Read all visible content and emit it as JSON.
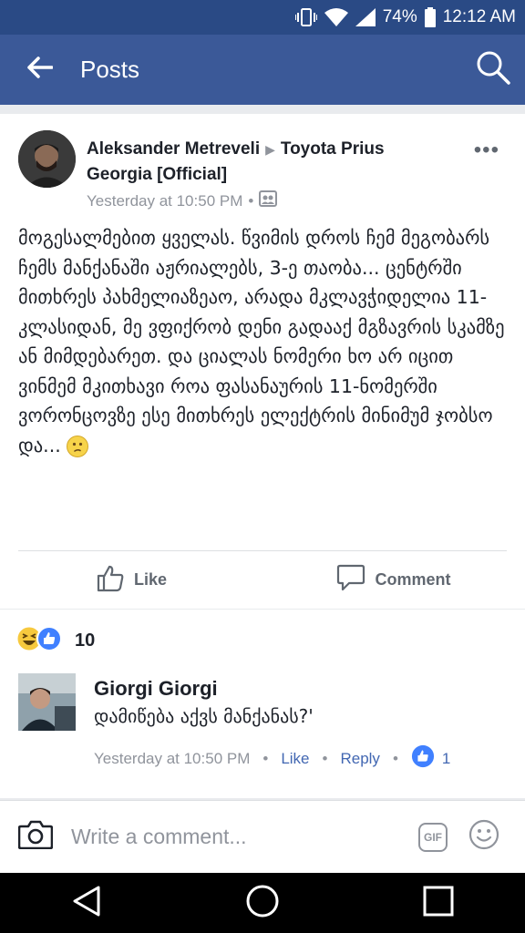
{
  "status_bar": {
    "battery": "74%",
    "time": "12:12 AM"
  },
  "app_bar": {
    "title": "Posts"
  },
  "post": {
    "author": "Aleksander Metreveli",
    "target": "Toyota Prius Georgia [Official]",
    "timestamp": "Yesterday at 10:50 PM",
    "text": "მოგესალმებით ყველას. წვიმის დროს ჩემ მეგობარს ჩემს მანქანაში აჟრიალებს, 3-ე თაობა... ცენტრში მითხრეს პახმელიაზეაო, არადა მკლავჭიდელია 11-კლასიდან, მე ვფიქრობ დენი გადააქ მგზავრის სკამზე ან მიმდებარეთ. და ციალას ნომერი ხო არ იცით ვინმემ მკითხავი როა ფასანაურის 11-ნომერში ვორონცოვზე ესე მითხრეს ელექტრის მინიმუმ ჯობსო და...",
    "like_label": "Like",
    "comment_label": "Comment"
  },
  "reactions": {
    "count": "10"
  },
  "comment": {
    "author": "Giorgi Giorgi",
    "text": "დამიწება აქვს მანქანას?'",
    "timestamp": "Yesterday at 10:50 PM",
    "like_label": "Like",
    "reply_label": "Reply",
    "like_count": "1"
  },
  "composer": {
    "placeholder": "Write a comment...",
    "gif_label": "GIF"
  },
  "colors": {
    "brand": "#3b5998",
    "status": "#2a4a85",
    "link": "#4267b2",
    "like": "#4080ff"
  },
  "icons": [
    "vibrate-icon",
    "wifi-icon",
    "signal-icon",
    "battery-icon",
    "back-arrow-icon",
    "search-icon",
    "more-icon",
    "audience-icon",
    "like-icon",
    "comment-icon",
    "haha-icon",
    "camera-icon",
    "gif-icon",
    "smiley-icon",
    "nav-back-icon",
    "nav-home-icon",
    "nav-recents-icon"
  ]
}
